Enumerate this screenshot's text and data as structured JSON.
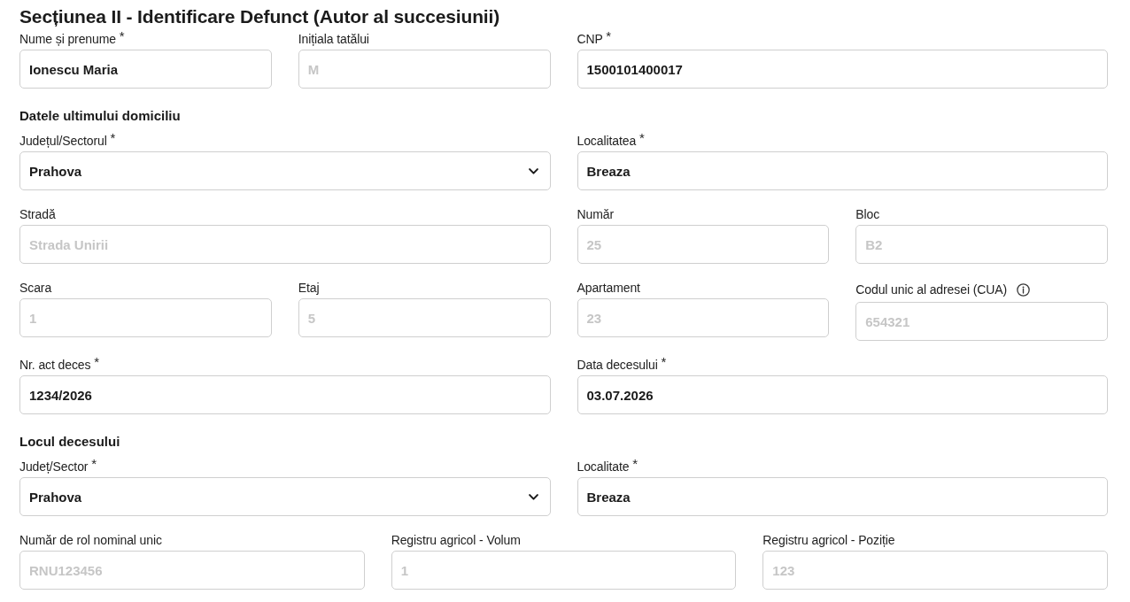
{
  "title": "Secțiunea II - Identificare Defunct (Autor al succesiunii)",
  "blocks": [
    {
      "kind": "row",
      "fields": [
        {
          "kind": "text",
          "label": "Nume și prenume $^{*}$",
          "value": "Ionescu Maria"
        },
        {
          "kind": "text",
          "label": "Inițiala tatălui",
          "placeholder": "M"
        },
        {
          "kind": "text",
          "label": "CNP $^{*}$",
          "value": "1500101400017"
        }
      ]
    },
    {
      "kind": "heading",
      "text": "Datele ultimului domiciliu"
    },
    {
      "kind": "row",
      "fields": [
        {
          "kind": "select",
          "label": "Județul/Sectorul $^{*}$",
          "value": "Prahova"
        },
        {
          "kind": "text",
          "label": "Localitatea $^{*}$",
          "value": "Breaza"
        }
      ]
    },
    {
      "kind": "row",
      "fields": [
        {
          "kind": "text",
          "label": "Stradă",
          "placeholder": "Strada Unirii"
        },
        {
          "kind": "text",
          "label": "Număr",
          "placeholder": "25"
        },
        {
          "kind": "text",
          "label": "Bloc",
          "placeholder": "B2"
        }
      ]
    },
    {
      "kind": "row",
      "fields": [
        {
          "kind": "text",
          "label": "Scara",
          "placeholder": "1"
        },
        {
          "kind": "text",
          "label": "Etaj",
          "placeholder": "5"
        },
        {
          "kind": "text",
          "label": "Apartament",
          "placeholder": "23"
        },
        {
          "kind": "text",
          "label": "Codul unic al adresei (CUA)",
          "info": true,
          "placeholder": "654321"
        }
      ]
    },
    {
      "kind": "row",
      "fields": [
        {
          "kind": "text",
          "label": "Nr. act deces $^{*}$",
          "value": "1234/2026"
        },
        {
          "kind": "text",
          "label": "Data decesului $^{*}$",
          "value": "03.07.2026"
        }
      ]
    },
    {
      "kind": "heading",
      "text": "Locul decesului"
    },
    {
      "kind": "row",
      "fields": [
        {
          "kind": "select",
          "label": "Județ/Sector $^{*}$",
          "value": "Prahova"
        },
        {
          "kind": "text",
          "label": "Localitate $^{*}$",
          "value": "Breaza"
        }
      ]
    },
    {
      "kind": "row",
      "fields": [
        {
          "kind": "text",
          "label": "Număr de rol nominal unic",
          "placeholder": "RNU123456"
        },
        {
          "kind": "text",
          "label": "Registru agricol - Volum",
          "placeholder": "1"
        },
        {
          "kind": "text",
          "label": "Registru agricol - Poziție",
          "placeholder": "123"
        }
      ]
    }
  ]
}
